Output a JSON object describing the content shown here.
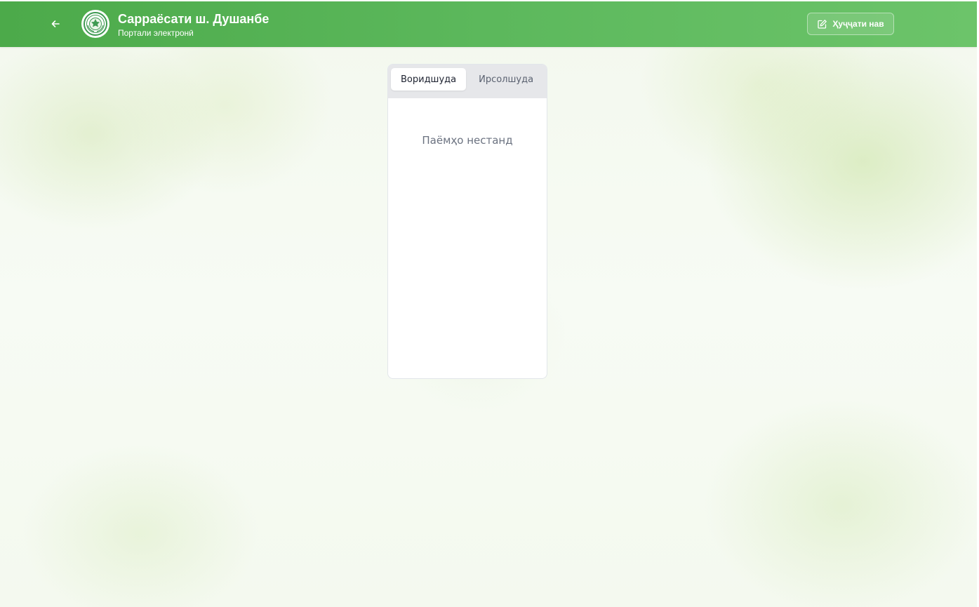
{
  "header": {
    "title": "Сарраёсати ш. Душанбе",
    "subtitle": "Портали электронӣ",
    "back_icon": "arrow-left-icon",
    "logo_icon": "emblem-logo",
    "new_doc_label": "Ҳуҷҷати нав",
    "new_doc_icon": "edit-square-icon",
    "color": "#5cb85c"
  },
  "messages": {
    "tabs": [
      {
        "label": "Воридшуда",
        "active": true
      },
      {
        "label": "Ирсолшуда",
        "active": false
      }
    ],
    "empty_text": "Паёмҳо нестанд"
  }
}
